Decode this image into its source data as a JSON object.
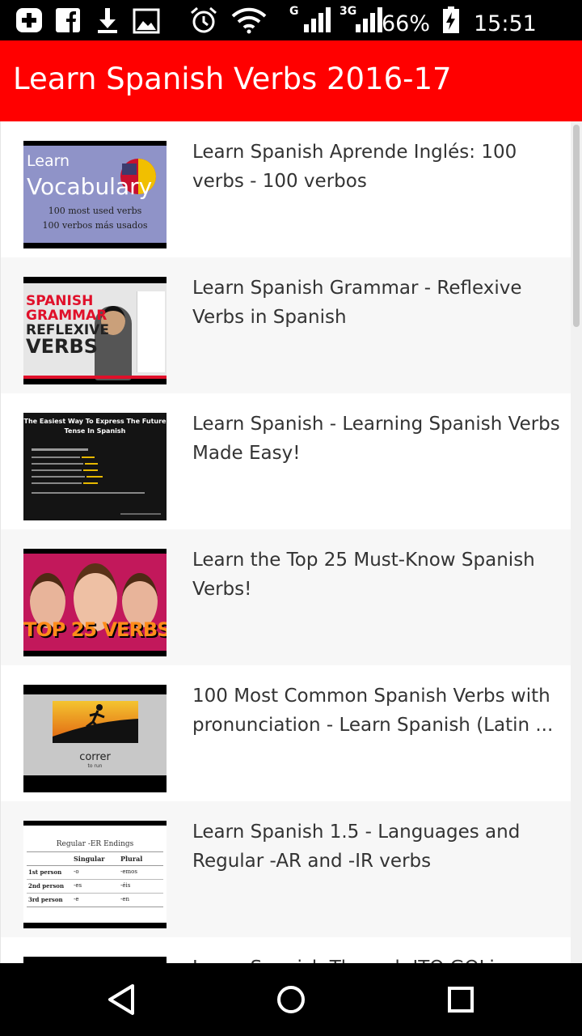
{
  "status_bar": {
    "signal_g": "G",
    "signal_3g": "3G",
    "battery_percent": "66%",
    "time": "15:51",
    "icons": [
      "add-icon",
      "facebook-icon",
      "download-icon",
      "image-icon",
      "alarm-icon",
      "wifi-icon",
      "signal-icon",
      "signal-3g-icon",
      "battery-charging-icon"
    ]
  },
  "app_bar": {
    "title": "Learn Spanish Verbs 2016-17",
    "color": "#ff0000"
  },
  "videos": [
    {
      "title": "Learn Spanish Aprende Inglés: 100 verbs - 100 verbos",
      "thumb_line1": "Learn",
      "thumb_line2": "Vocabulary",
      "thumb_line3": "100 most used verbs",
      "thumb_line4": "100 verbos más usados"
    },
    {
      "title": "Learn Spanish Grammar - Reflexive Verbs in Spanish",
      "thumb_line1": "SPANISH",
      "thumb_line2": "GRAMMAR",
      "thumb_line3": "REFLEXIVE",
      "thumb_line4": "VERBS"
    },
    {
      "title": "Learn Spanish - Learning Spanish Verbs Made Easy!",
      "thumb_line1": "The Easiest Way To Express The Future",
      "thumb_line2": "Tense In Spanish"
    },
    {
      "title": "Learn the Top 25 Must-Know Spanish Verbs!",
      "thumb_line1": "TOP 25 VERBS"
    },
    {
      "title": "100 Most Common Spanish Verbs with pronunciation - Learn Spanish (Latin ...",
      "thumb_line1": "correr",
      "thumb_line2": "to run"
    },
    {
      "title": "Learn Spanish 1.5 - Languages and Regular -AR and -IR verbs",
      "thumb_line1": "Regular -ER Endings",
      "thumb_col1": "Singular",
      "thumb_col2": "Plural",
      "thumb_rows": [
        [
          "1st person",
          "-o",
          "-emos"
        ],
        [
          "2nd person",
          "-es",
          "-éis"
        ],
        [
          "3rd person",
          "-e",
          "-en"
        ]
      ]
    },
    {
      "title": "Learn Spanish Through ITO GOLi..."
    }
  ],
  "nav_bar": {
    "icons": [
      "back-icon",
      "home-icon",
      "recents-icon"
    ]
  }
}
